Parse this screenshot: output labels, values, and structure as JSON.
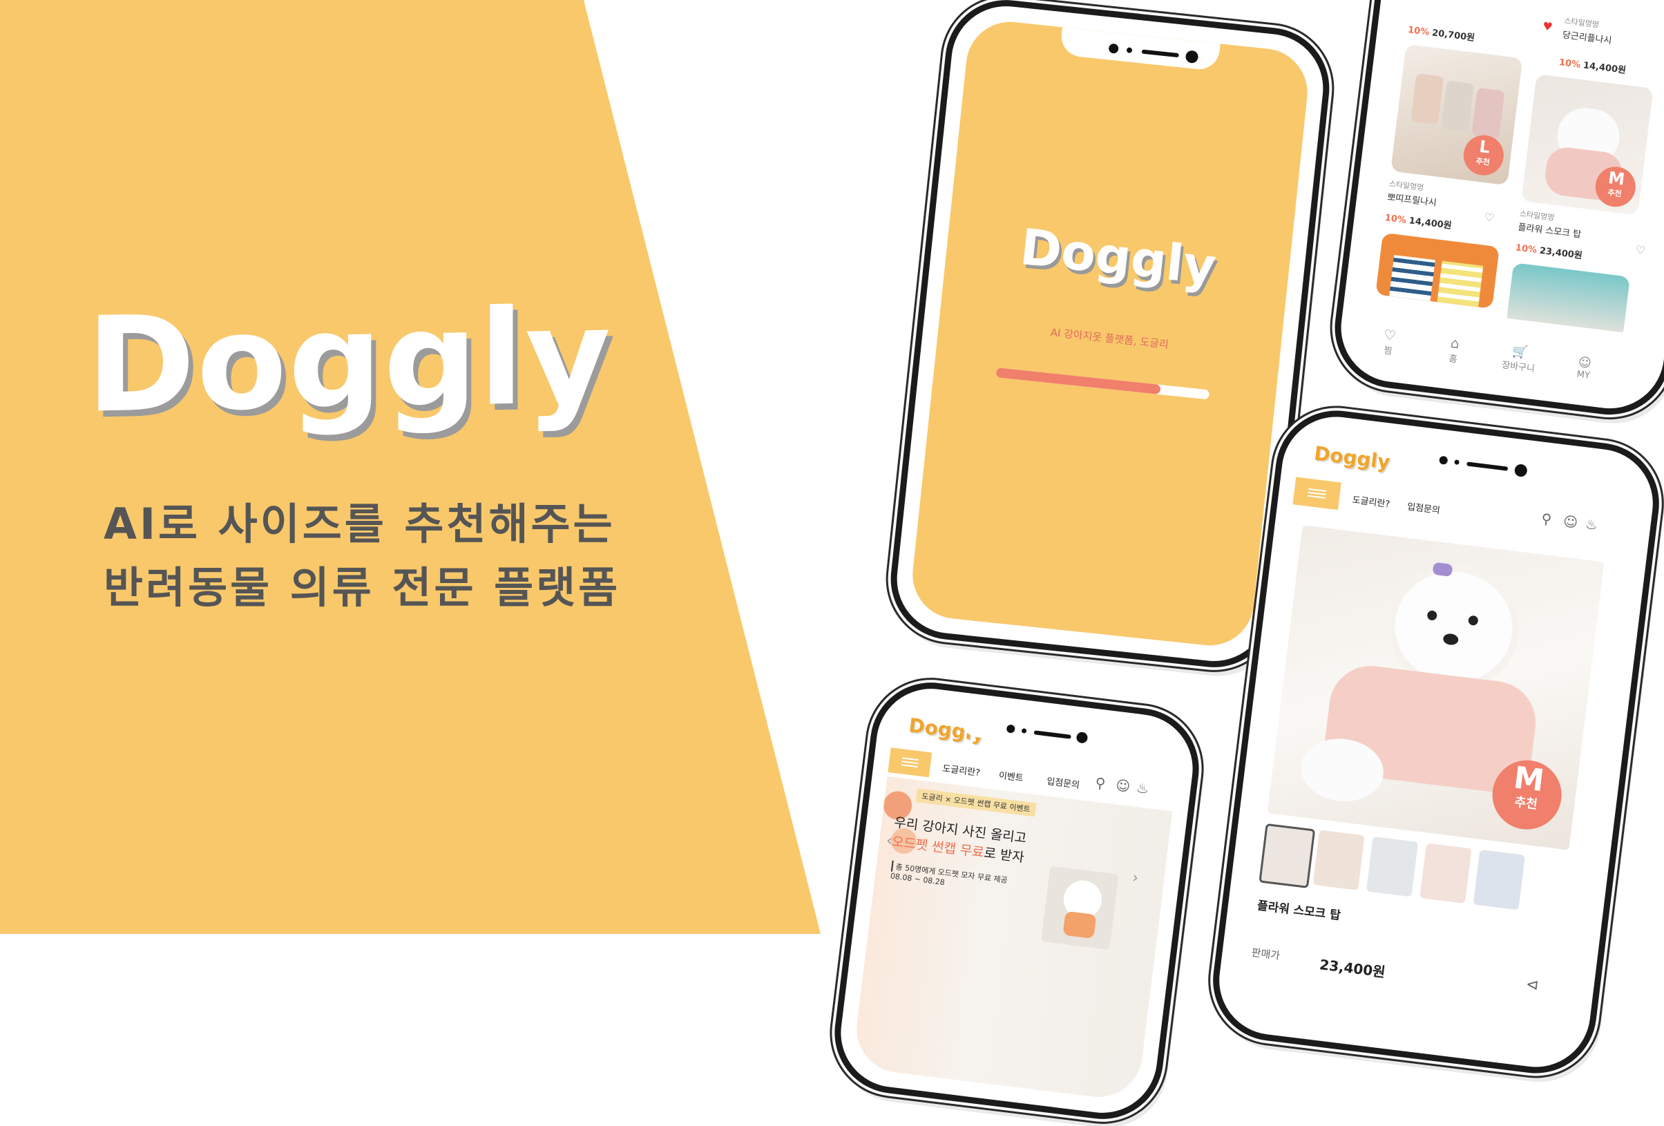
{
  "brand": {
    "logo": "Doggly",
    "tagline_line1": "AI로 사이즈를 추천해주는",
    "tagline_line2": "반려동물 의류 전문 플랫폼"
  },
  "colors": {
    "accent": "#f8c86b",
    "coral": "#f07f6b",
    "text": "#555555"
  },
  "splash": {
    "logo": "Doggly",
    "tagline": "AI 강아지옷 플랫폼, 도글리",
    "progress": 0.77
  },
  "list_screen": {
    "top": [
      {
        "seller": "스타일멍멍",
        "name": "당근리플나시",
        "discount": "10%",
        "price": "14,400원",
        "liked": true
      },
      {
        "discount": "10%",
        "price": "20,700원"
      }
    ],
    "items": [
      {
        "seller": "스타일멍멍",
        "name": "뽀띠프릴나시",
        "discount": "10%",
        "price": "14,400원",
        "badge": "L",
        "badge_sub": "추천"
      },
      {
        "seller": "스타일멍멍",
        "name": "플라워 스모크 탑",
        "discount": "10%",
        "price": "23,400원",
        "badge": "M",
        "badge_sub": "추천"
      }
    ],
    "tabs": [
      "찜",
      "홈",
      "장바구니",
      "MY"
    ],
    "icons": [
      "heart-icon",
      "home-icon",
      "cart-icon",
      "user-icon"
    ]
  },
  "home_screen": {
    "logo": "Doggly",
    "nav": [
      "도글리란?",
      "이벤트",
      "입점문의"
    ],
    "banner_pill": "도글리 × 오드펫 썬캡 무료 이벤트",
    "banner_title1": "우리 강아지 사진 올리고",
    "banner_title2_highlight": "오드펫 썬캡 무료",
    "banner_title2_rest": "로 받자",
    "banner_note": "총 50명에게 오드펫 모자 무료 제공",
    "banner_dates": "08.08 ~ 08.28"
  },
  "detail_screen": {
    "logo": "Doggly",
    "nav": [
      "도글리란?",
      "입점문의"
    ],
    "badge": "M",
    "badge_sub": "추천",
    "product_name": "플라워 스모크 탑",
    "price_label": "판매가",
    "price": "23,400원"
  }
}
